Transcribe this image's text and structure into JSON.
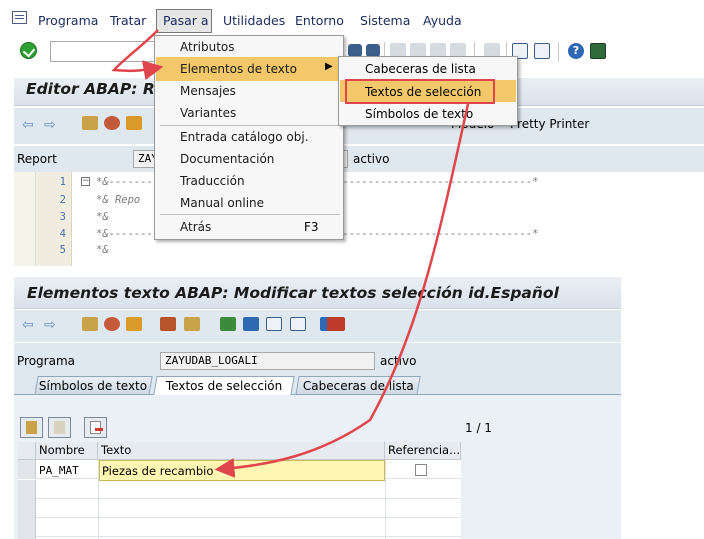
{
  "menubar": {
    "items": [
      {
        "label": "Programa"
      },
      {
        "label": "Tratar"
      },
      {
        "label": "Pasar a"
      },
      {
        "label": "Utilidades"
      },
      {
        "label": "Entorno"
      },
      {
        "label": "Sistema"
      },
      {
        "label": "Ayuda"
      }
    ]
  },
  "menu_pasar_a": {
    "items": [
      {
        "label": "Atributos"
      },
      {
        "label": "Elementos de texto"
      },
      {
        "label": "Mensajes"
      },
      {
        "label": "Variantes"
      },
      {
        "label": "Entrada catálogo obj."
      },
      {
        "label": "Documentación"
      },
      {
        "label": "Traducción"
      },
      {
        "label": "Manual online"
      },
      {
        "label": "Atrás",
        "shortcut": "F3"
      }
    ]
  },
  "submenu_elementos": {
    "items": [
      {
        "label": "Cabeceras de lista"
      },
      {
        "label": "Textos de selección"
      },
      {
        "label": "Símbolos de texto"
      }
    ]
  },
  "editor": {
    "title": "Editor ABAP: R",
    "report_label": "Report",
    "report_value": "ZAY",
    "status": "activo",
    "toolbar_extra": [
      "Modelo",
      "Pretty Printer"
    ],
    "line_numbers": [
      "1",
      "2",
      "3",
      "4",
      "5"
    ],
    "code_lines": [
      "*&-------------------------------------------------------------------*",
      "*& Repo",
      "*&",
      "*&-------------------------------------------------------------------*",
      "*&"
    ]
  },
  "text_editor": {
    "title": "Elementos texto ABAP: Modificar textos selección id.Español",
    "program_label": "Programa",
    "program_value": "ZAYUDAB_LOGALI",
    "status": "activo",
    "tabs": [
      {
        "label": "Símbolos de texto"
      },
      {
        "label": "Textos de selección"
      },
      {
        "label": "Cabeceras de lista"
      }
    ],
    "page_indicator": "1 / 1",
    "columns": [
      {
        "label": "Nombre"
      },
      {
        "label": "Texto"
      },
      {
        "label": "Referencia..."
      }
    ],
    "rows": [
      {
        "name": "PA_MAT",
        "text": "Piezas de recambio",
        "referencia": false
      }
    ]
  },
  "colors": {
    "highlight": "#f3c86a",
    "annotation_red": "#e0454b",
    "panel_bg": "#dfe7ef"
  }
}
